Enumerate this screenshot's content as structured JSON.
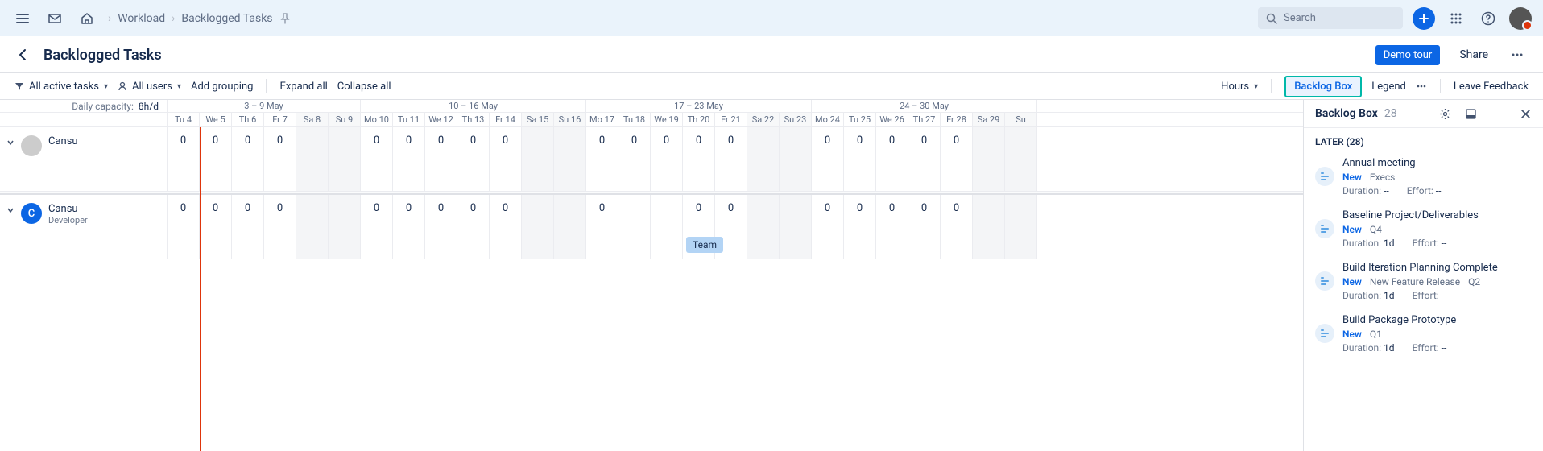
{
  "topbar": {
    "breadcrumb": [
      "Workload",
      "Backlogged Tasks"
    ],
    "search_placeholder": "Search"
  },
  "page": {
    "title": "Backlogged Tasks",
    "demo_label": "Demo tour",
    "share_label": "Share"
  },
  "toolbar": {
    "filter_label": "All active tasks",
    "users_label": "All users",
    "add_grouping": "Add grouping",
    "expand_all": "Expand all",
    "collapse_all": "Collapse all",
    "hours_label": "Hours",
    "backlog_box": "Backlog Box",
    "legend": "Legend",
    "feedback": "Leave Feedback"
  },
  "capacity_label": "Daily capacity:",
  "capacity_value": "8h/d",
  "weeks": [
    {
      "label": "3 – 9 May",
      "span": 6
    },
    {
      "label": "10 – 16 May",
      "span": 7
    },
    {
      "label": "17 – 23 May",
      "span": 7
    },
    {
      "label": "24 – 30 May",
      "span": 7
    }
  ],
  "days": [
    "Tu 4",
    "We 5",
    "Th 6",
    "Fr 7",
    "Sa 8",
    "Su 9",
    "Mo 10",
    "Tu 11",
    "We 12",
    "Th 13",
    "Fr 14",
    "Sa 15",
    "Su 16",
    "Mo 17",
    "Tu 18",
    "We 19",
    "Th 20",
    "Fr 21",
    "Sa 22",
    "Su 23",
    "Mo 24",
    "Tu 25",
    "We 26",
    "Th 27",
    "Fr 28",
    "Sa 29",
    "Su"
  ],
  "weekend_idx": [
    4,
    5,
    11,
    12,
    18,
    19,
    25,
    26
  ],
  "people": [
    {
      "name": "Cansu",
      "role": "",
      "avatar_type": "image",
      "cells": [
        "0",
        "0",
        "0",
        "0",
        "",
        "",
        "0",
        "0",
        "0",
        "0",
        "0",
        "",
        "",
        "0",
        "0",
        "0",
        "0",
        "0",
        "",
        "",
        "0",
        "0",
        "0",
        "0",
        "0",
        "",
        ""
      ]
    },
    {
      "name": "Cansu",
      "role": "Developer",
      "avatar_type": "letter",
      "avatar_letter": "C",
      "cells": [
        "0",
        "0",
        "0",
        "0",
        "",
        "",
        "0",
        "0",
        "0",
        "0",
        "0",
        "",
        "",
        "0",
        "",
        "",
        "0",
        "0",
        "",
        "",
        "0",
        "0",
        "0",
        "0",
        "0",
        "",
        ""
      ],
      "team_chip": {
        "label": "Team",
        "col": 16
      }
    }
  ],
  "backlog": {
    "title": "Backlog Box",
    "count": "28",
    "section": "LATER (28)",
    "items": [
      {
        "title": "Annual meeting",
        "status": "New",
        "tags": [
          "Execs"
        ],
        "duration": "--",
        "effort": "--"
      },
      {
        "title": "Baseline Project/Deliverables",
        "status": "New",
        "tags": [
          "Q4"
        ],
        "duration": "1d",
        "effort": "--"
      },
      {
        "title": "Build Iteration Planning Complete",
        "status": "New",
        "tags": [
          "New Feature Release",
          "Q2"
        ],
        "duration": "1d",
        "effort": "--"
      },
      {
        "title": "Build Package Prototype",
        "status": "New",
        "tags": [
          "Q1"
        ],
        "duration": "1d",
        "effort": "--"
      }
    ],
    "duration_label": "Duration:",
    "effort_label": "Effort:"
  }
}
